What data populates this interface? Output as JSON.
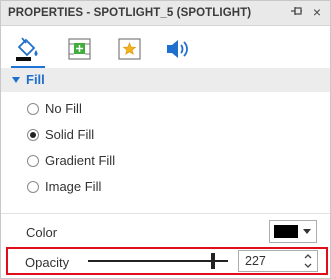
{
  "panel": {
    "title": "PROPERTIES - SPOTLIGHT_5 (SPOTLIGHT)",
    "close_glyph": "×"
  },
  "tabs": [
    {
      "name": "fill",
      "icon": "paint-bucket-icon",
      "active": true
    },
    {
      "name": "texture",
      "icon": "texture-icon"
    },
    {
      "name": "image",
      "icon": "star-image-icon"
    },
    {
      "name": "audio",
      "icon": "speaker-icon"
    }
  ],
  "fill_section": {
    "label": "Fill",
    "options": [
      {
        "label": "No Fill",
        "checked": false
      },
      {
        "label": "Solid Fill",
        "checked": true
      },
      {
        "label": "Gradient Fill",
        "checked": false
      },
      {
        "label": "Image Fill",
        "checked": false
      }
    ]
  },
  "color": {
    "label": "Color",
    "value": "#000000"
  },
  "opacity": {
    "label": "Opacity",
    "value": "227",
    "slider_fraction": 0.89
  },
  "colors": {
    "accent": "#1e73d8",
    "highlight": "#e00d1c"
  }
}
